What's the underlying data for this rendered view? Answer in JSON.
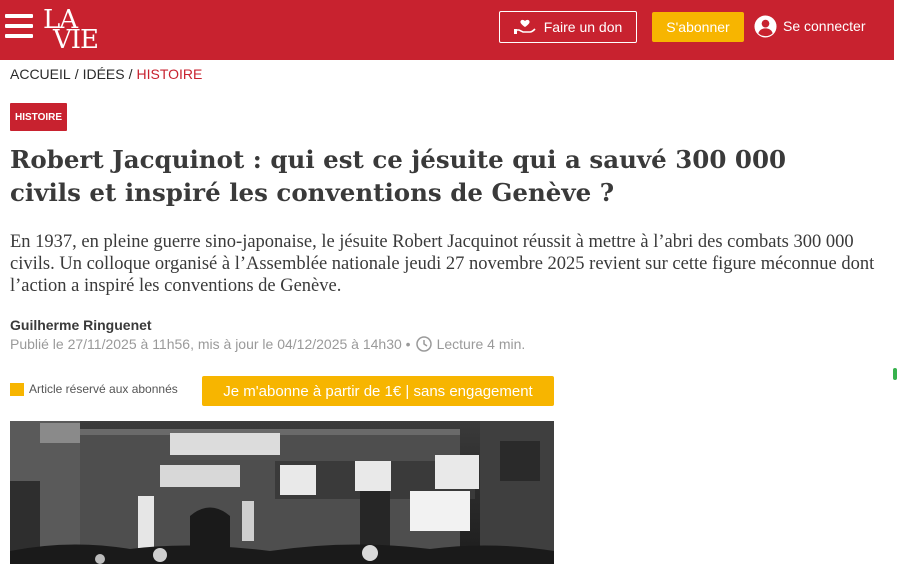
{
  "header": {
    "logo_top": "LA",
    "logo_bottom": "VIE",
    "donate_label": "Faire un don",
    "subscribe_label": "S'abonner",
    "login_label": "Se connecter"
  },
  "breadcrumb": {
    "items": [
      "ACCUEIL",
      "IDÉES",
      "HISTOIRE"
    ],
    "separator": "/"
  },
  "article": {
    "tag": "HISTOIRE",
    "title": "Robert Jacquinot : qui est ce jésuite qui a sauvé 300 000 civils et inspiré les conventions de Genève ?",
    "lede": "En 1937, en pleine guerre sino-japonaise, le jésuite Robert Jacquinot réussit à mettre à l’abri des combats 300 000 civils. Un colloque organisé à l’Assemblée nationale jeudi 27 novembre 2025 revient sur cette figure méconnue dont l’action a inspiré les conventions de Genève.",
    "author": "Guilherme Ringuenet",
    "meta": "Publié le 27/11/2025 à 11h56, mis à jour le 04/12/2025 à 14h30 •",
    "reading_time": "Lecture 4 min.",
    "reserved_label": "Article réservé aux abonnés",
    "offer_label": "Je m'abonne à partir de 1€ | sans engagement"
  },
  "colors": {
    "brand_red": "#c8222f",
    "accent_yellow": "#f7b500"
  },
  "icons": {
    "menu": "hamburger-icon",
    "donate": "hand-heart-icon",
    "user": "user-circle-icon",
    "clock": "clock-icon"
  }
}
